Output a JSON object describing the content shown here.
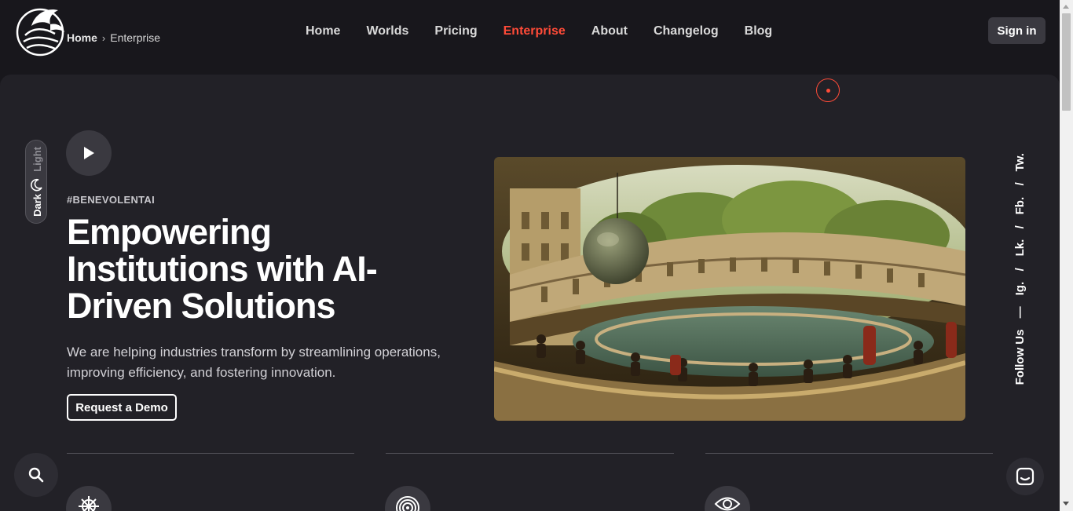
{
  "breadcrumb": {
    "home": "Home",
    "separator": "›",
    "current": "Enterprise"
  },
  "nav": {
    "items": [
      "Home",
      "Worlds",
      "Pricing",
      "Enterprise",
      "About",
      "Changelog",
      "Blog"
    ],
    "active": "Enterprise",
    "accent_color": "#ff4b38"
  },
  "header": {
    "signin_label": "Sign in"
  },
  "theme_toggle": {
    "light_label": "Light",
    "dark_label": "Dark",
    "icon": "moon-icon"
  },
  "hero": {
    "hashtag": "#BENEVOLENTAI",
    "headline": "Empowering Institutions with AI-Driven Solutions",
    "subtext": "We are helping industries transform by streamlining operations, improving efficiency, and fostering innovation.",
    "cta_label": "Request a Demo",
    "play_icon": "play-icon",
    "image_description": "amphitheater-painting"
  },
  "follow": {
    "label": "Follow Us",
    "dash": "—",
    "links": [
      "Ig.",
      "Lk.",
      "Fb.",
      "Tw."
    ],
    "separator": "/"
  },
  "features": {
    "icons": [
      "ship-wheel-icon",
      "target-rings-icon",
      "eye-icon"
    ]
  },
  "fabs": {
    "search_icon": "search-icon",
    "chat_icon": "chat-icon"
  },
  "colors": {
    "background": "#18171c",
    "panel": "#222127",
    "accent": "#ff4b38"
  }
}
